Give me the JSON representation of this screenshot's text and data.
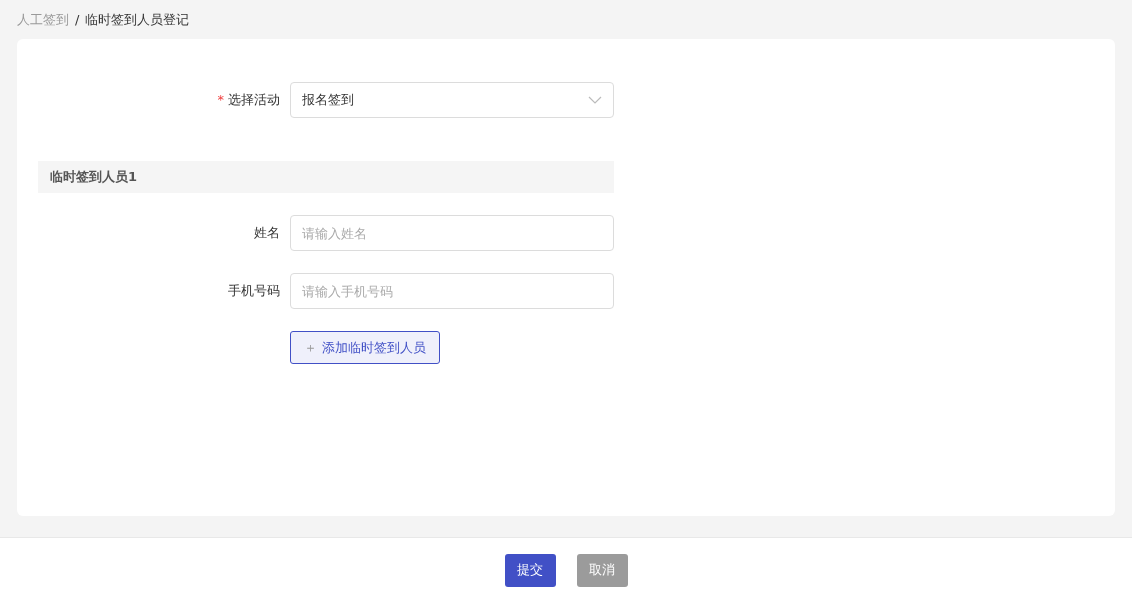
{
  "breadcrumb": [
    {
      "label": "人工签到",
      "current": false
    },
    {
      "label": "临时签到人员登记",
      "current": true
    }
  ],
  "separator": "/",
  "activity": {
    "label": "选择活动",
    "required": true,
    "required_mark": "*",
    "value": "报名签到"
  },
  "sections": [
    {
      "title": "临时签到人员1",
      "fields": [
        {
          "label": "姓名",
          "placeholder": "请输入姓名"
        },
        {
          "label": "手机号码",
          "placeholder": "请输入手机号码"
        }
      ]
    }
  ],
  "add_button": {
    "icon": "＋",
    "label": "添加临时签到人员"
  },
  "footer_buttons": [
    {
      "label": "提交",
      "kind": "primary"
    },
    {
      "label": "取消",
      "kind": "secondary"
    }
  ]
}
